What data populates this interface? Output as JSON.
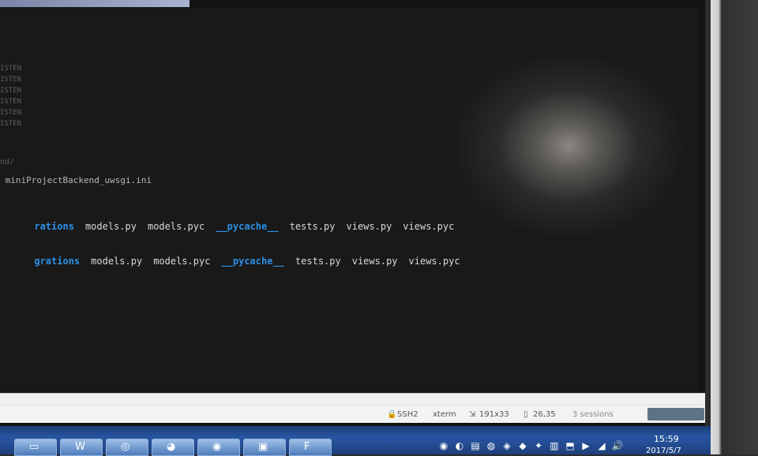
{
  "terminal": {
    "faint_lines": [
      "ISTEN",
      "ISTEN",
      "ISTEN",
      "ISTEN",
      "ISTEN",
      "ISTEN"
    ],
    "path_fragment": "nd/",
    "ini_line": " miniProjectBackend_uwsgi.ini",
    "listing1": {
      "dir_fragment": "rations",
      "files": [
        "models.py",
        "models.pyc"
      ],
      "pycache": "__pycache__",
      "files2": [
        "tests.py",
        "views.py",
        "views.pyc"
      ]
    },
    "listing2": {
      "dir_fragment": "grations",
      "files": [
        "models.py",
        "models.pyc"
      ],
      "pycache": "__pycache__",
      "files2": [
        "tests.py",
        "views.py",
        "views.pyc"
      ]
    }
  },
  "status_bar": {
    "ssh": "SSH2",
    "term": "xterm",
    "size": "191x33",
    "cursor": "26,35",
    "sessions": "3 sessions"
  },
  "taskbar": {
    "buttons": [
      {
        "icon": "window-icon",
        "glyph": "▭"
      },
      {
        "icon": "word-icon",
        "glyph": "W"
      },
      {
        "icon": "swirl-app-icon",
        "glyph": "◎"
      },
      {
        "icon": "yellow-app-icon",
        "glyph": "◕"
      },
      {
        "icon": "browser-icon",
        "glyph": "◉"
      },
      {
        "icon": "remote-desktop-icon",
        "glyph": "▣"
      },
      {
        "icon": "green-app-icon",
        "glyph": "F"
      }
    ],
    "tray": [
      "◉",
      "◐",
      "▤",
      "◍",
      "◈",
      "◆",
      "✦",
      "▥",
      "⬒",
      "▶",
      "◢",
      "🔊"
    ],
    "clock_time": "15:59",
    "clock_date": "2017/5/7"
  }
}
